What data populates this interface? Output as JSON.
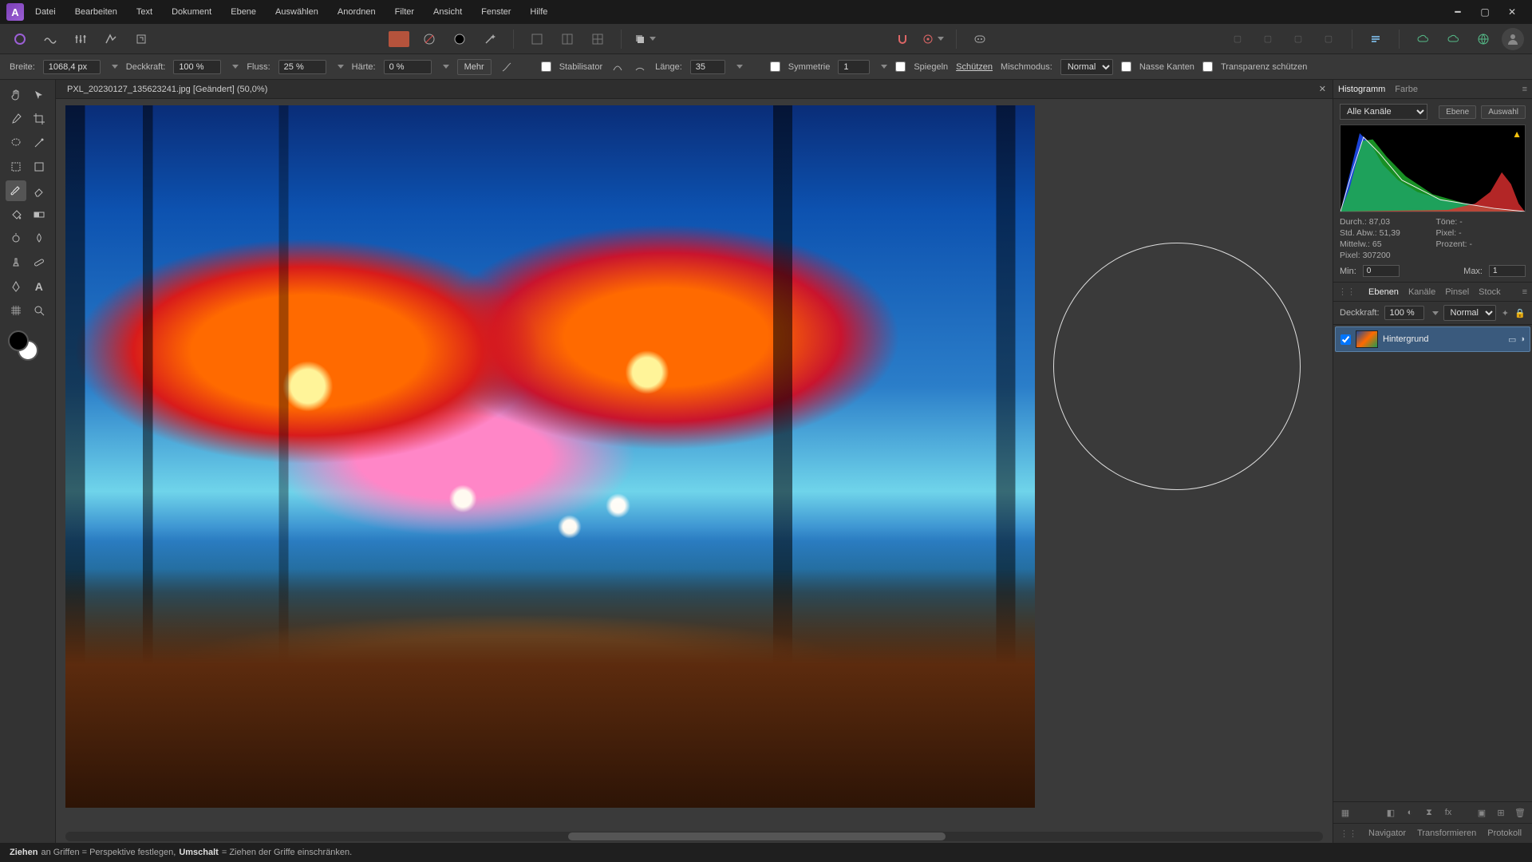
{
  "menu": {
    "items": [
      "Datei",
      "Bearbeiten",
      "Text",
      "Dokument",
      "Ebene",
      "Auswählen",
      "Anordnen",
      "Filter",
      "Ansicht",
      "Fenster",
      "Hilfe"
    ]
  },
  "app_initial": "A",
  "doc": {
    "tab_title": "PXL_20230127_135623241.jpg [Geändert] (50,0%)"
  },
  "ctx": {
    "width_label": "Breite:",
    "width_value": "1068,4 px",
    "opacity_label": "Deckkraft:",
    "opacity_value": "100 %",
    "flow_label": "Fluss:",
    "flow_value": "25 %",
    "hardness_label": "Härte:",
    "hardness_value": "0 %",
    "more": "Mehr",
    "stabilizer": "Stabilisator",
    "length_label": "Länge:",
    "length_value": "35",
    "symmetry": "Symmetrie",
    "symmetry_value": "1",
    "mirror": "Spiegeln",
    "protect": "Schützen",
    "blend_label": "Mischmodus:",
    "blend_value": "Normal",
    "wet_edges": "Nasse Kanten",
    "protect_alpha": "Transparenz schützen"
  },
  "hist": {
    "tab_hist": "Histogramm",
    "tab_color": "Farbe",
    "channel": "Alle Kanäle",
    "btn_layer": "Ebene",
    "btn_sel": "Auswahl",
    "mean_label": "Durch.:",
    "mean_val": "87,03",
    "std_label": "Std. Abw.:",
    "std_val": "51,39",
    "median_label": "Mittelw.:",
    "median_val": "65",
    "pixels_label": "Pixel:",
    "pixels_val": "307200",
    "tones_label": "Töne:",
    "tones_val": "-",
    "pct_label": "Prozent:",
    "pct_val": "-",
    "px_label": "Pixel:",
    "px_val": "-",
    "min_label": "Min:",
    "min_val": "0",
    "max_label": "Max:",
    "max_val": "1"
  },
  "layers": {
    "tab_layers": "Ebenen",
    "tab_channels": "Kanäle",
    "tab_brush": "Pinsel",
    "tab_stock": "Stock",
    "opacity_label": "Deckkraft:",
    "opacity_value": "100 %",
    "blend": "Normal",
    "items": [
      {
        "name": "Hintergrund"
      }
    ]
  },
  "nav": {
    "tab_nav": "Navigator",
    "tab_trans": "Transformieren",
    "tab_hist": "Protokoll"
  },
  "status": {
    "p1": "Ziehen",
    "p2": " an Griffen = Perspektive festlegen, ",
    "p3": "Umschalt",
    "p4": " = Ziehen der Griffe einschränken."
  }
}
